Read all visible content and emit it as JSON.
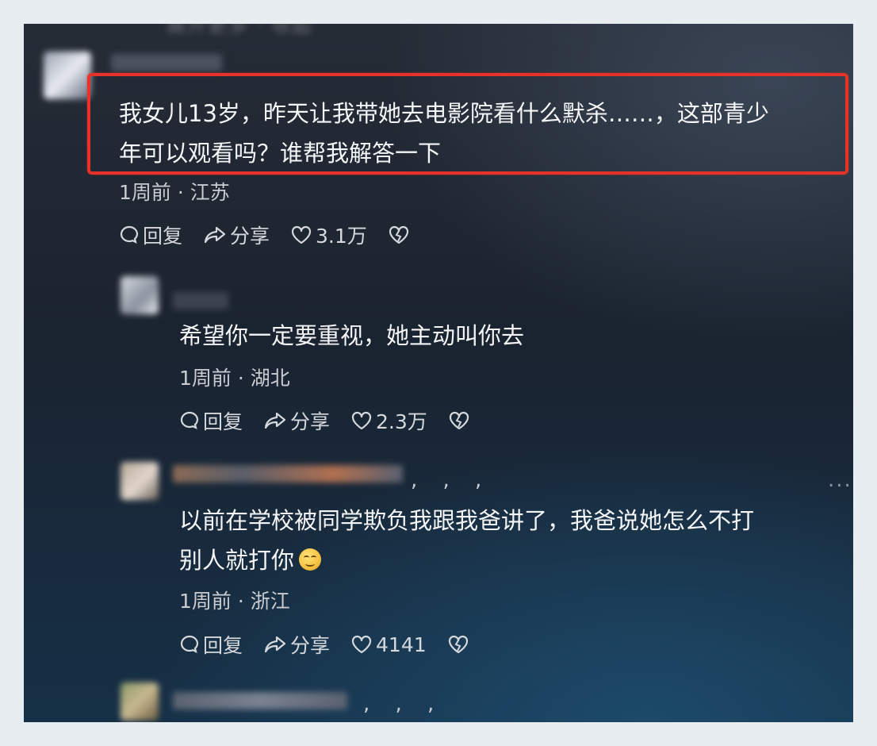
{
  "comments": [
    {
      "text_line1": "我女儿13岁，昨天让我带她去电影院看什么默杀……，这部青少",
      "text_line2": "年可以观看吗？谁帮我解答一下",
      "time": "1周前",
      "location": "江苏",
      "reply_label": "回复",
      "share_label": "分享",
      "likes": "3.1万"
    },
    {
      "text_line1": "希望你一定要重视，她主动叫你去",
      "time": "1周前",
      "location": "湖北",
      "reply_label": "回复",
      "share_label": "分享",
      "likes": "2.3万"
    },
    {
      "text_line1": "以前在学校被同学欺负我跟我爸讲了，我爸说她怎么不打",
      "text_line2": "别人就打你",
      "time": "1周前",
      "location": "浙江",
      "reply_label": "回复",
      "share_label": "分享",
      "likes": "4141"
    }
  ],
  "separator": "·",
  "punct_fragments": [
    ",  ,  ,",
    ",  ,  ,"
  ],
  "more_label": "...",
  "icons": [
    "comment-icon",
    "share-icon",
    "heart-icon",
    "broken-heart-icon"
  ],
  "colors": {
    "highlight_border": "#e6332a"
  }
}
